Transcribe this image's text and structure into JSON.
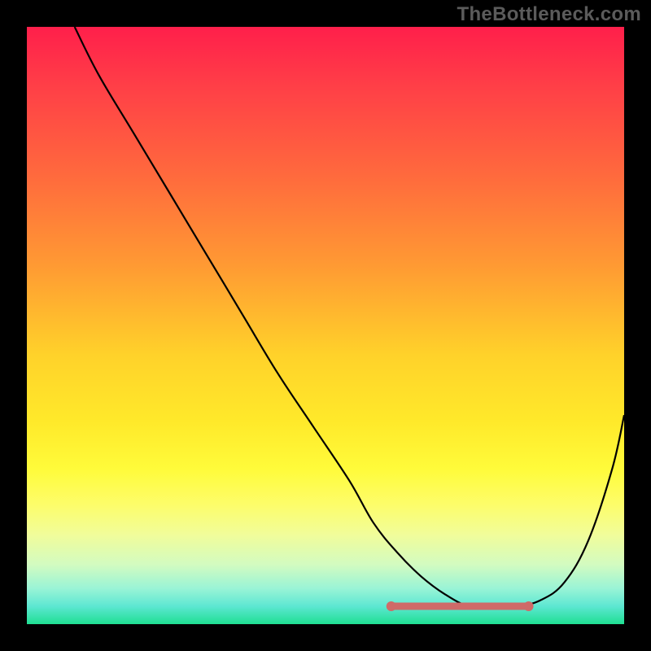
{
  "watermark": "TheBottleneck.com",
  "colors": {
    "page_bg": "#000000",
    "curve": "#000000",
    "saddle": "#cf6a68",
    "watermark": "#5b5b5b"
  },
  "chart_data": {
    "type": "line",
    "title": "",
    "xlabel": "",
    "ylabel": "",
    "xlim": [
      0,
      100
    ],
    "ylim": [
      0,
      100
    ],
    "grid": false,
    "series": [
      {
        "name": "bottleneck-curve",
        "x": [
          8,
          12,
          18,
          24,
          30,
          36,
          42,
          48,
          54,
          58,
          62,
          66,
          70,
          74,
          78,
          82,
          86,
          90,
          94,
          98,
          100
        ],
        "values": [
          100,
          92,
          82,
          72,
          62,
          52,
          42,
          33,
          24,
          17,
          12,
          8,
          5,
          3,
          3,
          3,
          4,
          7,
          14,
          26,
          35
        ]
      }
    ],
    "annotations": {
      "saddle_region_x": [
        61,
        84
      ],
      "saddle_y": 3
    }
  }
}
